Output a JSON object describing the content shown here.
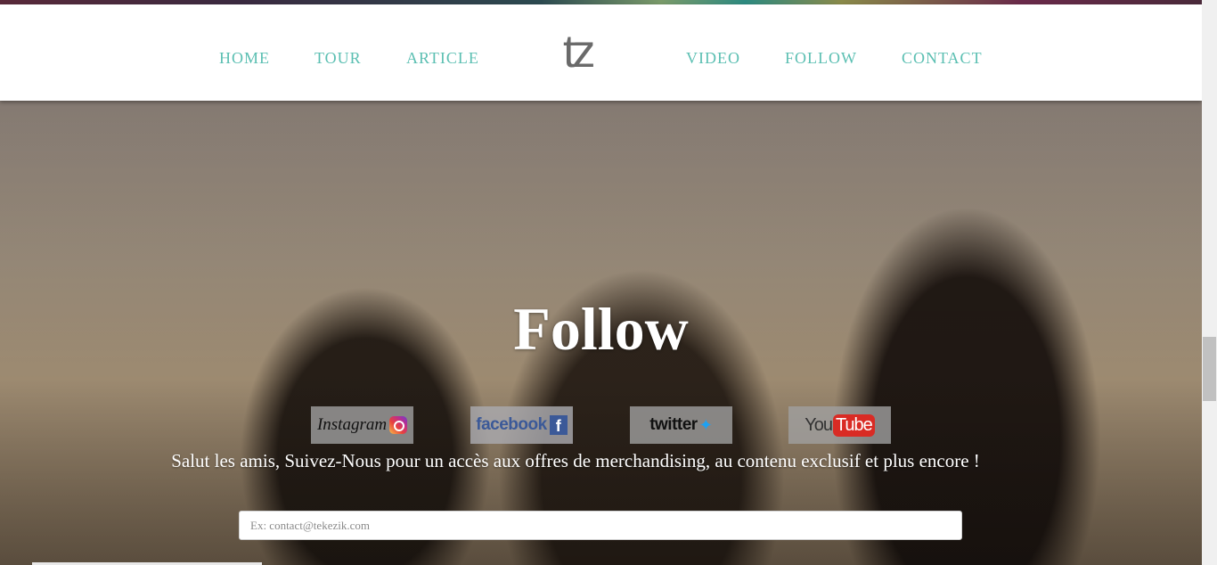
{
  "nav": {
    "left": [
      "HOME",
      "TOUR",
      "ARTICLE"
    ],
    "right": [
      "VIDEO",
      "FOLLOW",
      "CONTACT"
    ],
    "logo": "tz"
  },
  "hero": {
    "title": "Follow",
    "subtitle": "Salut les amis, Suivez-Nous pour un accès aux offres de merchandising, au contenu exclusif et plus encore !"
  },
  "social": {
    "instagram": "Instagram",
    "facebook": "facebook",
    "twitter": "twitter",
    "youtube_you": "You",
    "youtube_tube": "Tube"
  },
  "form": {
    "email_placeholder": "Ex: contact@tekezik.com",
    "email_value": ""
  },
  "colors": {
    "nav_link": "#5bbfb2",
    "logo": "#6a6a6a",
    "navbar_bg": "#ffffff"
  }
}
